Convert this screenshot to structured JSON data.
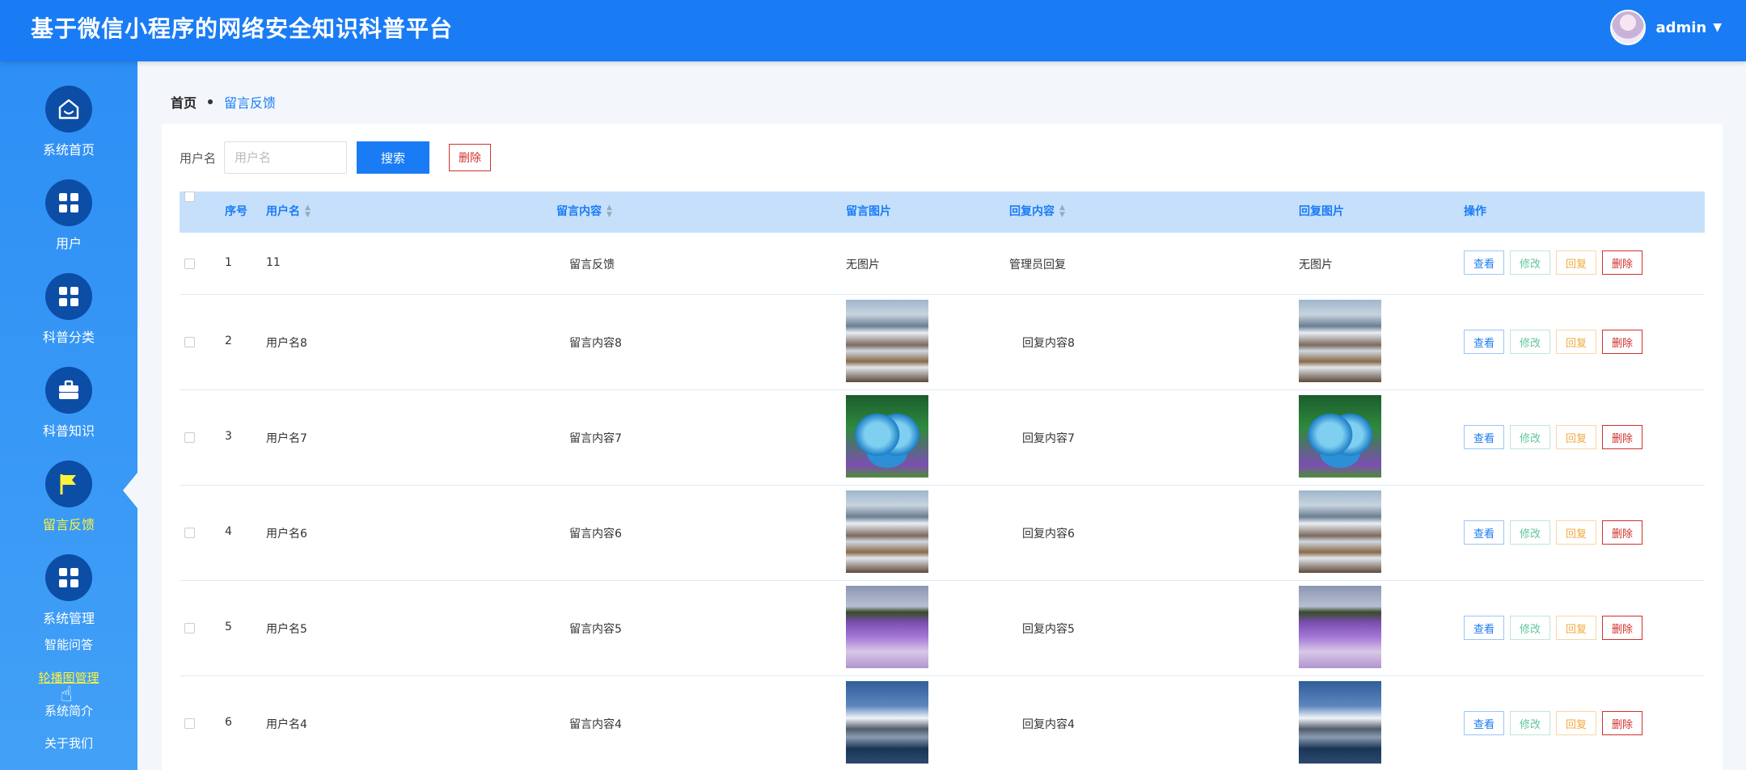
{
  "app": {
    "title": "基于微信小程序的网络安全知识科普平台"
  },
  "user": {
    "name": "admin"
  },
  "sidebar": {
    "icon_items": [
      {
        "label": "系统首页",
        "icon": "home-icon"
      },
      {
        "label": "用户",
        "icon": "grid-icon"
      },
      {
        "label": "科普分类",
        "icon": "grid-icon"
      },
      {
        "label": "科普知识",
        "icon": "briefcase-icon"
      },
      {
        "label": "留言反馈",
        "icon": "flag-icon",
        "active": true
      },
      {
        "label": "系统管理",
        "icon": "grid-icon"
      }
    ],
    "text_items": [
      {
        "label": "智能问答"
      },
      {
        "label": "轮播图管理",
        "active": true
      },
      {
        "label": "系统简介"
      },
      {
        "label": "关于我们"
      }
    ]
  },
  "breadcrumb": {
    "home": "首页",
    "current": "留言反馈"
  },
  "search": {
    "label": "用户名",
    "placeholder": "用户名",
    "search_button": "搜索",
    "delete_button": "删除"
  },
  "table": {
    "headers": {
      "index": "序号",
      "username": "用户名",
      "message": "留言内容",
      "message_image": "留言图片",
      "reply": "回复内容",
      "reply_image": "回复图片",
      "actions": "操作"
    },
    "action_labels": {
      "view": "查看",
      "edit": "修改",
      "reply": "回复",
      "delete": "删除"
    },
    "rows": [
      {
        "index": "1",
        "username": "11",
        "message": "留言反馈",
        "message_image": "无图片",
        "reply": "管理员回复",
        "reply_image": "无图片"
      },
      {
        "index": "2",
        "username": "用户名8",
        "message": "留言内容8",
        "message_image": "mountain-town",
        "reply": "回复内容8",
        "reply_image": "mountain-town"
      },
      {
        "index": "3",
        "username": "用户名7",
        "message": "留言内容7",
        "message_image": "heart-lake",
        "reply": "回复内容7",
        "reply_image": "heart-lake"
      },
      {
        "index": "4",
        "username": "用户名6",
        "message": "留言内容6",
        "message_image": "mountain-town",
        "reply": "回复内容6",
        "reply_image": "mountain-town"
      },
      {
        "index": "5",
        "username": "用户名5",
        "message": "留言内容5",
        "message_image": "lavender-field",
        "reply": "回复内容5",
        "reply_image": "lavender-field"
      },
      {
        "index": "6",
        "username": "用户名4",
        "message": "留言内容4",
        "message_image": "snow-mountain-lake",
        "reply": "回复内容4",
        "reply_image": "snow-mountain-lake"
      }
    ]
  },
  "colors": {
    "primary": "#1a7cf4",
    "sidebar": "#2d8ff5",
    "active_text": "#fff23a",
    "danger": "#d0312d"
  }
}
